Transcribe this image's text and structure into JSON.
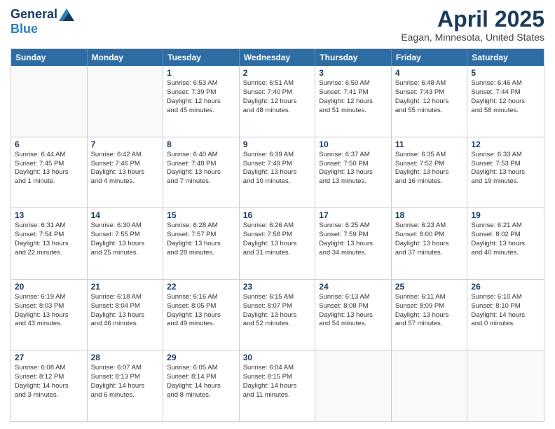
{
  "header": {
    "logo_general": "General",
    "logo_blue": "Blue",
    "title": "April 2025",
    "location": "Eagan, Minnesota, United States"
  },
  "days_of_week": [
    "Sunday",
    "Monday",
    "Tuesday",
    "Wednesday",
    "Thursday",
    "Friday",
    "Saturday"
  ],
  "weeks": [
    [
      {
        "day": "",
        "content": ""
      },
      {
        "day": "",
        "content": ""
      },
      {
        "day": "1",
        "content": "Sunrise: 6:53 AM\nSunset: 7:39 PM\nDaylight: 12 hours\nand 45 minutes."
      },
      {
        "day": "2",
        "content": "Sunrise: 6:51 AM\nSunset: 7:40 PM\nDaylight: 12 hours\nand 48 minutes."
      },
      {
        "day": "3",
        "content": "Sunrise: 6:50 AM\nSunset: 7:41 PM\nDaylight: 12 hours\nand 51 minutes."
      },
      {
        "day": "4",
        "content": "Sunrise: 6:48 AM\nSunset: 7:43 PM\nDaylight: 12 hours\nand 55 minutes."
      },
      {
        "day": "5",
        "content": "Sunrise: 6:46 AM\nSunset: 7:44 PM\nDaylight: 12 hours\nand 58 minutes."
      }
    ],
    [
      {
        "day": "6",
        "content": "Sunrise: 6:44 AM\nSunset: 7:45 PM\nDaylight: 13 hours\nand 1 minute."
      },
      {
        "day": "7",
        "content": "Sunrise: 6:42 AM\nSunset: 7:46 PM\nDaylight: 13 hours\nand 4 minutes."
      },
      {
        "day": "8",
        "content": "Sunrise: 6:40 AM\nSunset: 7:48 PM\nDaylight: 13 hours\nand 7 minutes."
      },
      {
        "day": "9",
        "content": "Sunrise: 6:39 AM\nSunset: 7:49 PM\nDaylight: 13 hours\nand 10 minutes."
      },
      {
        "day": "10",
        "content": "Sunrise: 6:37 AM\nSunset: 7:50 PM\nDaylight: 13 hours\nand 13 minutes."
      },
      {
        "day": "11",
        "content": "Sunrise: 6:35 AM\nSunset: 7:52 PM\nDaylight: 13 hours\nand 16 minutes."
      },
      {
        "day": "12",
        "content": "Sunrise: 6:33 AM\nSunset: 7:53 PM\nDaylight: 13 hours\nand 19 minutes."
      }
    ],
    [
      {
        "day": "13",
        "content": "Sunrise: 6:31 AM\nSunset: 7:54 PM\nDaylight: 13 hours\nand 22 minutes."
      },
      {
        "day": "14",
        "content": "Sunrise: 6:30 AM\nSunset: 7:55 PM\nDaylight: 13 hours\nand 25 minutes."
      },
      {
        "day": "15",
        "content": "Sunrise: 6:28 AM\nSunset: 7:57 PM\nDaylight: 13 hours\nand 28 minutes."
      },
      {
        "day": "16",
        "content": "Sunrise: 6:26 AM\nSunset: 7:58 PM\nDaylight: 13 hours\nand 31 minutes."
      },
      {
        "day": "17",
        "content": "Sunrise: 6:25 AM\nSunset: 7:59 PM\nDaylight: 13 hours\nand 34 minutes."
      },
      {
        "day": "18",
        "content": "Sunrise: 6:23 AM\nSunset: 8:00 PM\nDaylight: 13 hours\nand 37 minutes."
      },
      {
        "day": "19",
        "content": "Sunrise: 6:21 AM\nSunset: 8:02 PM\nDaylight: 13 hours\nand 40 minutes."
      }
    ],
    [
      {
        "day": "20",
        "content": "Sunrise: 6:19 AM\nSunset: 8:03 PM\nDaylight: 13 hours\nand 43 minutes."
      },
      {
        "day": "21",
        "content": "Sunrise: 6:18 AM\nSunset: 8:04 PM\nDaylight: 13 hours\nand 46 minutes."
      },
      {
        "day": "22",
        "content": "Sunrise: 6:16 AM\nSunset: 8:05 PM\nDaylight: 13 hours\nand 49 minutes."
      },
      {
        "day": "23",
        "content": "Sunrise: 6:15 AM\nSunset: 8:07 PM\nDaylight: 13 hours\nand 52 minutes."
      },
      {
        "day": "24",
        "content": "Sunrise: 6:13 AM\nSunset: 8:08 PM\nDaylight: 13 hours\nand 54 minutes."
      },
      {
        "day": "25",
        "content": "Sunrise: 6:11 AM\nSunset: 8:09 PM\nDaylight: 13 hours\nand 57 minutes."
      },
      {
        "day": "26",
        "content": "Sunrise: 6:10 AM\nSunset: 8:10 PM\nDaylight: 14 hours\nand 0 minutes."
      }
    ],
    [
      {
        "day": "27",
        "content": "Sunrise: 6:08 AM\nSunset: 8:12 PM\nDaylight: 14 hours\nand 3 minutes."
      },
      {
        "day": "28",
        "content": "Sunrise: 6:07 AM\nSunset: 8:13 PM\nDaylight: 14 hours\nand 6 minutes."
      },
      {
        "day": "29",
        "content": "Sunrise: 6:05 AM\nSunset: 8:14 PM\nDaylight: 14 hours\nand 8 minutes."
      },
      {
        "day": "30",
        "content": "Sunrise: 6:04 AM\nSunset: 8:15 PM\nDaylight: 14 hours\nand 11 minutes."
      },
      {
        "day": "",
        "content": ""
      },
      {
        "day": "",
        "content": ""
      },
      {
        "day": "",
        "content": ""
      }
    ]
  ]
}
